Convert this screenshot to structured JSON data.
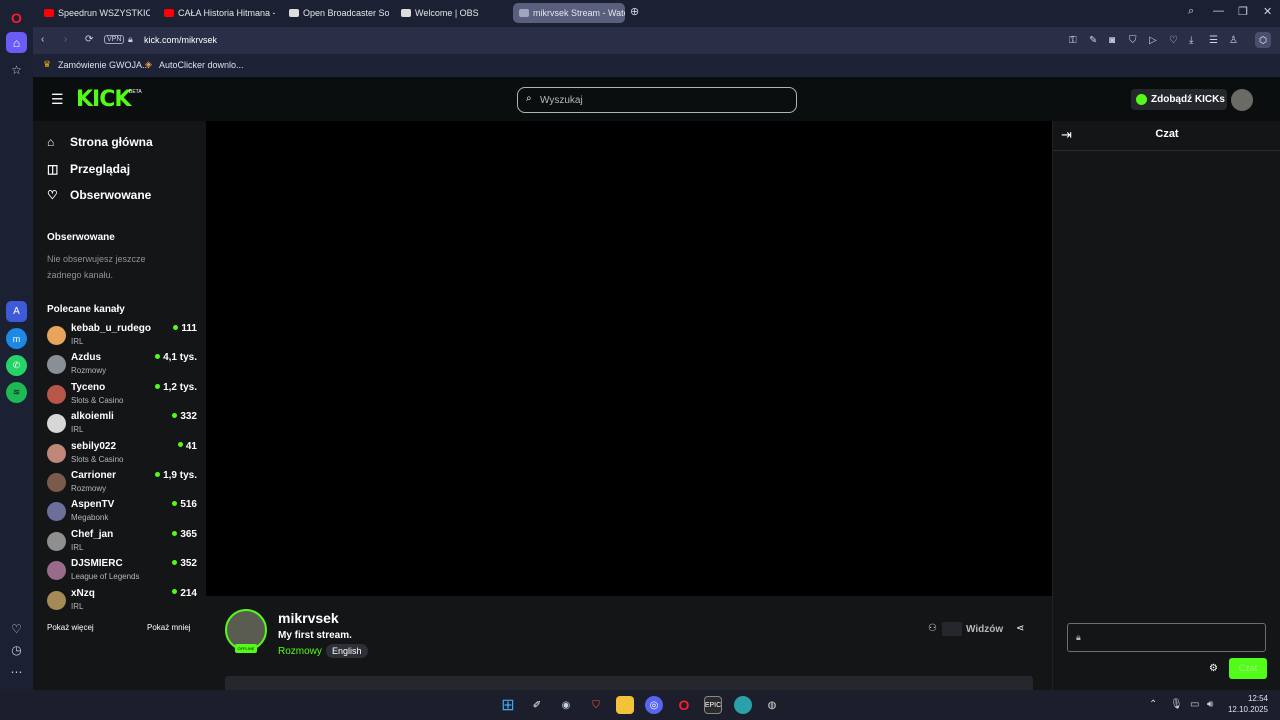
{
  "browser": {
    "tabs": [
      {
        "label": "Speedrun WSZYSTKICH H",
        "icon_color": "#ff0000"
      },
      {
        "label": "CAŁA Historia Hitmana - Y",
        "icon_color": "#ff0000"
      },
      {
        "label": "Open Broadcaster Softwa",
        "icon_color": "#dddddd"
      },
      {
        "label": "Welcome | OBS",
        "icon_color": "#dddddd"
      },
      {
        "label": "mikrvsek Stream - Watch",
        "icon_color": "#a0a4c0"
      }
    ],
    "address": "kick.com/mikrvsek",
    "vpn_label": "VPN",
    "bookmarks": [
      "Zamówienie GWOJA...",
      "AutoClicker downlo..."
    ]
  },
  "header": {
    "logo": "KICK",
    "logo_beta": "BETA",
    "search_placeholder": "Wyszukaj",
    "get_kicks": "Zdobądź KICKs"
  },
  "sidebar": {
    "nav": [
      {
        "label": "Strona główna",
        "icon": "home-icon"
      },
      {
        "label": "Przeglądaj",
        "icon": "browse-icon"
      },
      {
        "label": "Obserwowane",
        "icon": "heart-icon"
      }
    ],
    "followed_title": "Obserwowane",
    "followed_empty": "Nie obserwujesz jeszcze żadnego kanału.",
    "recommended_title": "Polecane kanały",
    "channels": [
      {
        "name": "kebab_u_rudego",
        "category": "IRL",
        "viewers": "111",
        "color": "#e8a35c"
      },
      {
        "name": "Azdus",
        "category": "Rozmowy",
        "viewers": "4,1 tys.",
        "color": "#8a8f96"
      },
      {
        "name": "Tyceno",
        "category": "Slots & Casino",
        "viewers": "1,2 tys.",
        "color": "#b9564a"
      },
      {
        "name": "alkoiemli",
        "category": "IRL",
        "viewers": "332",
        "color": "#d7d7d7"
      },
      {
        "name": "sebily022",
        "category": "Slots & Casino",
        "viewers": "41",
        "color": "#c0867a"
      },
      {
        "name": "Carrioner",
        "category": "Rozmowy",
        "viewers": "1,9 tys.",
        "color": "#7a5a4a"
      },
      {
        "name": "AspenTV",
        "category": "Megabonk",
        "viewers": "516",
        "color": "#6b6f9a"
      },
      {
        "name": "Chef_jan",
        "category": "IRL",
        "viewers": "365",
        "color": "#8f8f8f"
      },
      {
        "name": "DJSMIERC",
        "category": "League of Legends",
        "viewers": "352",
        "color": "#9a6a8a"
      },
      {
        "name": "xNzq",
        "category": "IRL",
        "viewers": "214",
        "color": "#a58a55"
      }
    ],
    "show_more": "Pokaż więcej",
    "show_less": "Pokaż mniej"
  },
  "stream": {
    "channel": "mikrvsek",
    "title": "My first stream.",
    "category": "Rozmowy",
    "language": "English",
    "viewers_label": "Widzów",
    "status_badge": "OFFLINE"
  },
  "chat": {
    "title": "Czat",
    "send_button": "Czat"
  },
  "taskbar": {
    "time": "12:54",
    "date": "12.10.2025"
  },
  "colors": {
    "accent": "#53fc18",
    "background": "#141517",
    "header": "#0b0e0f"
  }
}
